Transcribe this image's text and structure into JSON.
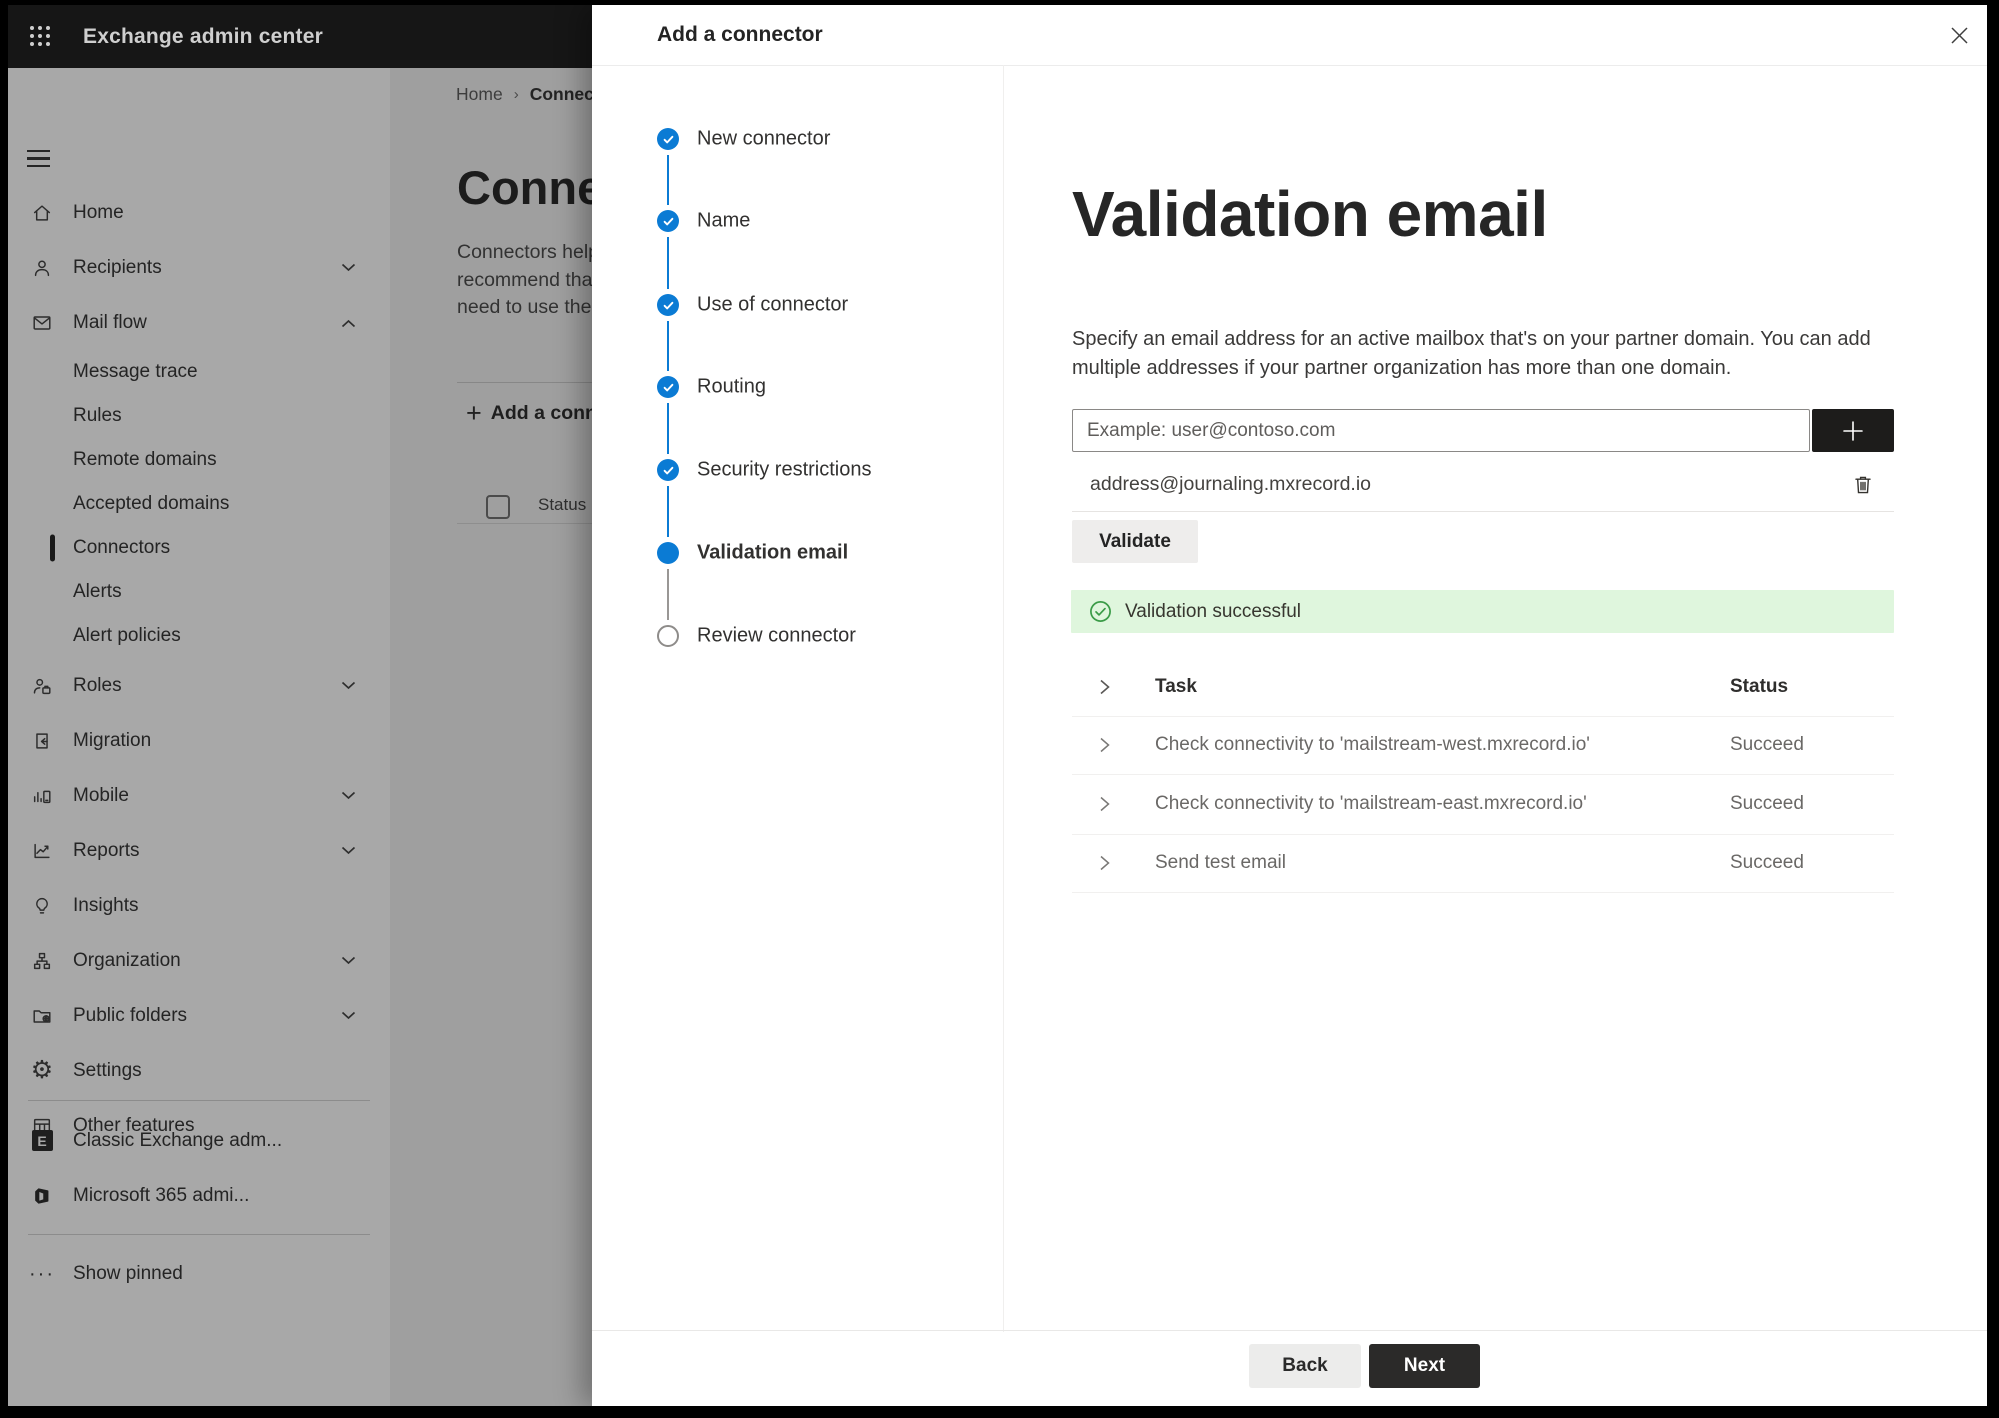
{
  "topbar": {
    "title": "Exchange admin center"
  },
  "sidebar": {
    "items": [
      {
        "label": "Home",
        "icon": "home"
      },
      {
        "label": "Recipients",
        "icon": "person",
        "chevron": "down"
      },
      {
        "label": "Mail flow",
        "icon": "mail",
        "chevron": "up"
      },
      {
        "label": "Message trace",
        "sub": true
      },
      {
        "label": "Rules",
        "sub": true
      },
      {
        "label": "Remote domains",
        "sub": true
      },
      {
        "label": "Accepted domains",
        "sub": true
      },
      {
        "label": "Connectors",
        "sub": true,
        "selected": true
      },
      {
        "label": "Alerts",
        "sub": true
      },
      {
        "label": "Alert policies",
        "sub": true
      },
      {
        "label": "Roles",
        "icon": "roles",
        "chevron": "down"
      },
      {
        "label": "Migration",
        "icon": "migration"
      },
      {
        "label": "Mobile",
        "icon": "mobile",
        "chevron": "down"
      },
      {
        "label": "Reports",
        "icon": "reports",
        "chevron": "down"
      },
      {
        "label": "Insights",
        "icon": "insights"
      },
      {
        "label": "Organization",
        "icon": "organization",
        "chevron": "down"
      },
      {
        "label": "Public folders",
        "icon": "public-folders",
        "chevron": "down"
      },
      {
        "label": "Settings",
        "icon": "settings"
      },
      {
        "label": "Other features",
        "icon": "other-features"
      }
    ],
    "footer_items": [
      {
        "label": "Classic Exchange adm...",
        "icon": "exchange-logo"
      },
      {
        "label": "Microsoft 365 admi...",
        "icon": "microsoft-365-logo"
      }
    ],
    "show_pinned": "Show pinned"
  },
  "background": {
    "breadcrumb": {
      "home": "Home",
      "current": "Connectors"
    },
    "page_title": "Connectors",
    "description_lines": [
      "Connectors help",
      "recommend that",
      "need to use ther"
    ],
    "add_button": "Add a conn",
    "list_header_status": "Status"
  },
  "modal": {
    "title": "Add a connector",
    "steps": [
      {
        "label": "New connector",
        "state": "complete"
      },
      {
        "label": "Name",
        "state": "complete"
      },
      {
        "label": "Use of connector",
        "state": "complete"
      },
      {
        "label": "Routing",
        "state": "complete"
      },
      {
        "label": "Security restrictions",
        "state": "complete"
      },
      {
        "label": "Validation email",
        "state": "current"
      },
      {
        "label": "Review connector",
        "state": "upcoming"
      }
    ],
    "heading": "Validation email",
    "description_lines": [
      "Specify an email address for an active mailbox that's on your partner domain. You can add",
      "multiple addresses if your partner organization has more than one domain."
    ],
    "email_input": {
      "value": "",
      "placeholder": "Example: user@contoso.com"
    },
    "address": "address@journaling.mxrecord.io",
    "validate_button": "Validate",
    "banner_text": "Validation successful",
    "table": {
      "headers": {
        "task": "Task",
        "status": "Status"
      },
      "rows": [
        {
          "task": "Check connectivity to 'mailstream-west.mxrecord.io'",
          "status": "Succeed"
        },
        {
          "task": "Check connectivity to 'mailstream-east.mxrecord.io'",
          "status": "Succeed"
        },
        {
          "task": "Send test email",
          "status": "Succeed"
        }
      ]
    },
    "back_button": "Back",
    "next_button": "Next"
  },
  "colors": {
    "accent_blue": "#0b7bd4",
    "success_green": "#3a9b47",
    "banner_background": "#dff6dd",
    "topbar_background": "#161616"
  }
}
